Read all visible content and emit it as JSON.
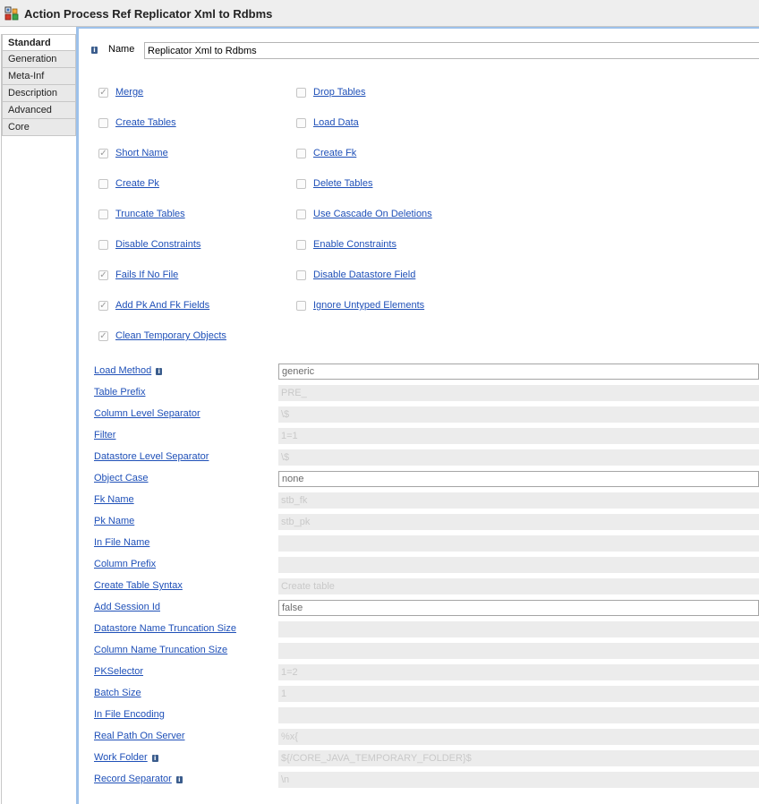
{
  "window": {
    "title": "Action Process Ref Replicator Xml to Rdbms",
    "icon": "action-process-icon"
  },
  "tabs": [
    {
      "label": "Standard",
      "active": true
    },
    {
      "label": "Generation",
      "active": false
    },
    {
      "label": "Meta-Inf",
      "active": false
    },
    {
      "label": "Description",
      "active": false
    },
    {
      "label": "Advanced",
      "active": false
    },
    {
      "label": "Core",
      "active": false
    }
  ],
  "name": {
    "label": "Name",
    "value": "Replicator Xml to Rdbms",
    "info_icon": "info-icon"
  },
  "checkboxes": {
    "merge": {
      "label": "Merge",
      "checked": true
    },
    "create_tables": {
      "label": "Create Tables",
      "checked": false
    },
    "short_name": {
      "label": "Short Name",
      "checked": true
    },
    "create_pk": {
      "label": "Create Pk",
      "checked": false
    },
    "truncate_tables": {
      "label": "Truncate Tables",
      "checked": false
    },
    "disable_constraints": {
      "label": "Disable Constraints",
      "checked": false
    },
    "fails_if_no_file": {
      "label": "Fails If No File",
      "checked": true
    },
    "add_pk_and_fk_fields": {
      "label": "Add Pk And Fk Fields",
      "checked": true
    },
    "clean_temporary_objects": {
      "label": "Clean Temporary Objects",
      "checked": true
    },
    "drop_tables": {
      "label": "Drop Tables",
      "checked": false
    },
    "load_data": {
      "label": "Load Data",
      "checked": false
    },
    "create_fk": {
      "label": "Create Fk",
      "checked": false
    },
    "delete_tables": {
      "label": "Delete Tables",
      "checked": false
    },
    "use_cascade_on_deletions": {
      "label": "Use Cascade On Deletions",
      "checked": false
    },
    "enable_constraints": {
      "label": "Enable Constraints",
      "checked": false
    },
    "disable_datastore_field": {
      "label": "Disable Datastore Field",
      "checked": false
    },
    "ignore_untyped_elements": {
      "label": "Ignore Untyped Elements",
      "checked": false
    }
  },
  "fields": {
    "load_method": {
      "label": "Load Method",
      "value": "generic",
      "info": true,
      "editable": true
    },
    "table_prefix": {
      "label": "Table Prefix",
      "value": "PRE_",
      "info": false,
      "editable": false
    },
    "column_level_separator": {
      "label": "Column Level Separator",
      "value": "\\$",
      "info": false,
      "editable": false
    },
    "filter": {
      "label": "Filter",
      "value": "1=1",
      "info": false,
      "editable": false
    },
    "datastore_level_separator": {
      "label": "Datastore Level Separator",
      "value": "\\$",
      "info": false,
      "editable": false
    },
    "object_case": {
      "label": "Object Case",
      "value": "none",
      "info": false,
      "editable": true
    },
    "fk_name": {
      "label": "Fk Name",
      "value": "stb_fk",
      "info": false,
      "editable": false
    },
    "pk_name": {
      "label": "Pk Name",
      "value": "stb_pk",
      "info": false,
      "editable": false
    },
    "in_file_name": {
      "label": "In File Name",
      "value": "",
      "info": false,
      "editable": false
    },
    "column_prefix": {
      "label": "Column Prefix",
      "value": "",
      "info": false,
      "editable": false
    },
    "create_table_syntax": {
      "label": "Create Table Syntax",
      "value": "Create table",
      "info": false,
      "editable": false
    },
    "add_session_id": {
      "label": "Add Session Id",
      "value": "false",
      "info": false,
      "editable": true
    },
    "datastore_name_truncation_size": {
      "label": "Datastore Name Truncation Size",
      "value": "",
      "info": false,
      "editable": false
    },
    "column_name_truncation_size": {
      "label": "Column Name Truncation Size",
      "value": "",
      "info": false,
      "editable": false
    },
    "pkselector": {
      "label": "PKSelector",
      "value": "1=2",
      "info": false,
      "editable": false
    },
    "batch_size": {
      "label": "Batch Size",
      "value": "1",
      "info": false,
      "editable": false
    },
    "in_file_encoding": {
      "label": "In File Encoding",
      "value": "",
      "info": false,
      "editable": false
    },
    "real_path_on_server": {
      "label": "Real Path On Server",
      "value": "%x{",
      "info": false,
      "editable": false
    },
    "work_folder": {
      "label": "Work Folder",
      "value": "${/CORE_JAVA_TEMPORARY_FOLDER}$",
      "info": true,
      "editable": false
    },
    "record_separator": {
      "label": "Record Separator",
      "value": "\\n",
      "info": true,
      "editable": false
    }
  },
  "colors": {
    "link": "#1f50b8",
    "accent_border": "#9dc1ea",
    "info_icon": "#3b5d8d",
    "disabled_field_bg": "#ececec"
  }
}
